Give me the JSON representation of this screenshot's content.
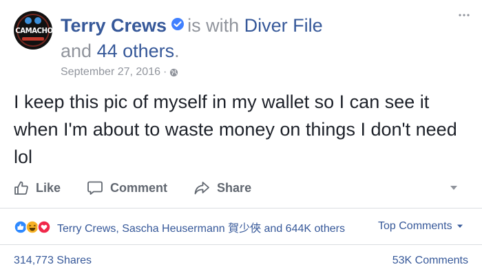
{
  "post": {
    "avatar_text": "CAMACHO",
    "author": "Terry Crews",
    "with_label": "is with",
    "tagged_user": "Diver File",
    "and_label": "and",
    "others_link": "44 others",
    "period": ".",
    "date": "September 27, 2016",
    "date_separator": "·",
    "text": "I keep this pic of myself in my wallet so I can see it when I'm about to waste money on things I don't need lol"
  },
  "actions": {
    "like_label": "Like",
    "comment_label": "Comment",
    "share_label": "Share"
  },
  "reactions": {
    "names": "Terry Crews, Sascha Heusermann 賀少俠 and 644K others",
    "top_comments_label": "Top Comments"
  },
  "counts": {
    "shares": "314,773 Shares",
    "comments": "53K Comments"
  },
  "colors": {
    "link": "#365899",
    "muted": "#90949c",
    "like_reaction": "#2e89ff",
    "haha_reaction": "#f7b125",
    "love_reaction": "#f0284a"
  },
  "icons": [
    "more-options-icon",
    "verified-badge-icon",
    "globe-icon",
    "like-icon",
    "comment-icon",
    "share-icon",
    "chevron-down-icon",
    "like-reaction-icon",
    "haha-reaction-icon",
    "love-reaction-icon"
  ]
}
